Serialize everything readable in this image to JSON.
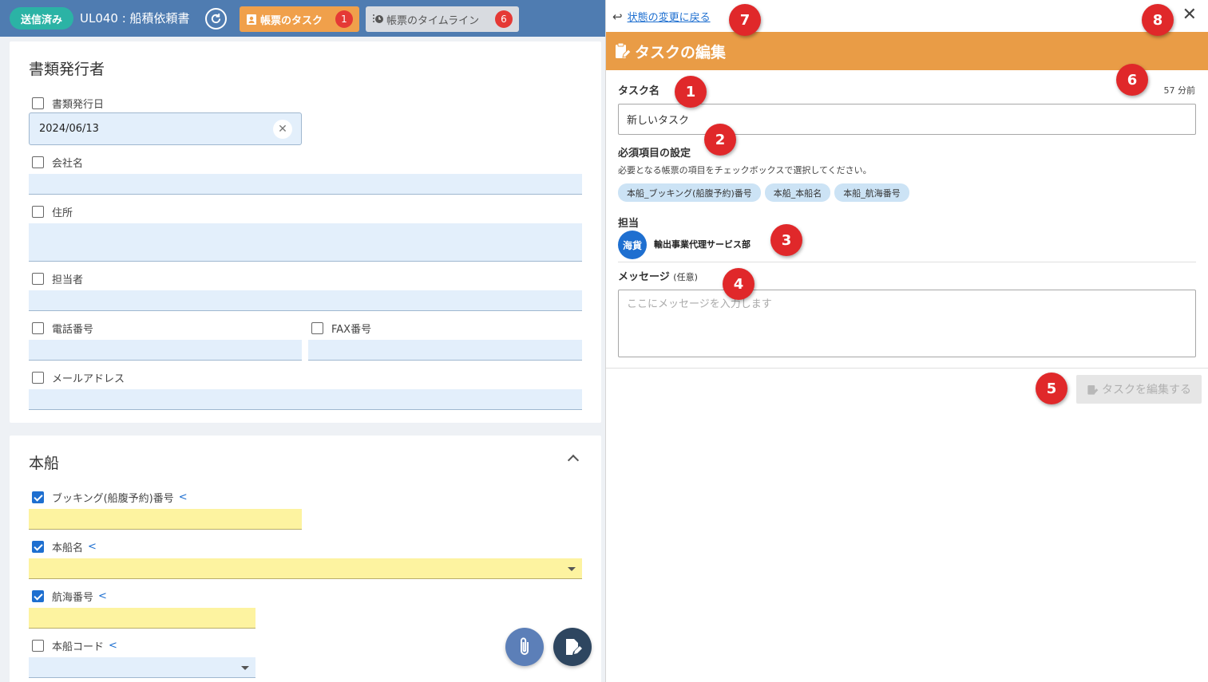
{
  "topbar": {
    "status": "送信済み",
    "title": "UL040 : 船積依頼書",
    "task_tab": {
      "label": "帳票のタスク",
      "count": "1"
    },
    "timeline_tab": {
      "label": "帳票のタイムライン",
      "count": "6"
    }
  },
  "issuer_section": {
    "heading": "書類発行者",
    "issue_date": {
      "label": "書類発行日",
      "value": "2024/06/13"
    },
    "company": {
      "label": "会社名"
    },
    "address": {
      "label": "住所"
    },
    "person": {
      "label": "担当者"
    },
    "phone": {
      "label": "電話番号"
    },
    "fax": {
      "label": "FAX番号"
    },
    "email": {
      "label": "メールアドレス"
    }
  },
  "vessel_section": {
    "heading": "本船",
    "booking": {
      "label": "ブッキング(船腹予約)番号",
      "checked": true
    },
    "vessel_name": {
      "label": "本船名",
      "checked": true
    },
    "voyage": {
      "label": "航海番号",
      "checked": true
    },
    "vessel_code": {
      "label": "本船コード",
      "checked": false
    }
  },
  "panel": {
    "back_link": "状態の変更に戻る",
    "header_title": "タスクの編集",
    "task_name_label": "タスク名",
    "time_ago": "57 分前",
    "task_name_value": "新しいタスク",
    "required_label": "必須項目の設定",
    "required_desc": "必要となる帳票の項目をチェックボックスで選択してください。",
    "required_chips": [
      "本船_ブッキング(船腹予約)番号",
      "本船_本船名",
      "本船_航海番号"
    ],
    "assignee_label": "担当",
    "assignee_avatar": "海貨",
    "assignee_name": "輸出事業代理サービス部",
    "message_label": "メッセージ",
    "message_optional": "(任意)",
    "message_placeholder": "ここにメッセージを入力します",
    "submit_label": "タスクを編集する"
  },
  "markers": [
    "1",
    "2",
    "3",
    "4",
    "5",
    "6",
    "7",
    "8"
  ],
  "colors": {
    "topbar": "#4f7cb1",
    "status_pill": "#2bb3a5",
    "task_tab": "#f0a04b",
    "panel_header": "#e99c46",
    "field_blue": "#e3effb",
    "field_yellow": "#fdf3a0",
    "marker": "#e0282a",
    "link": "#1e6fd0"
  }
}
